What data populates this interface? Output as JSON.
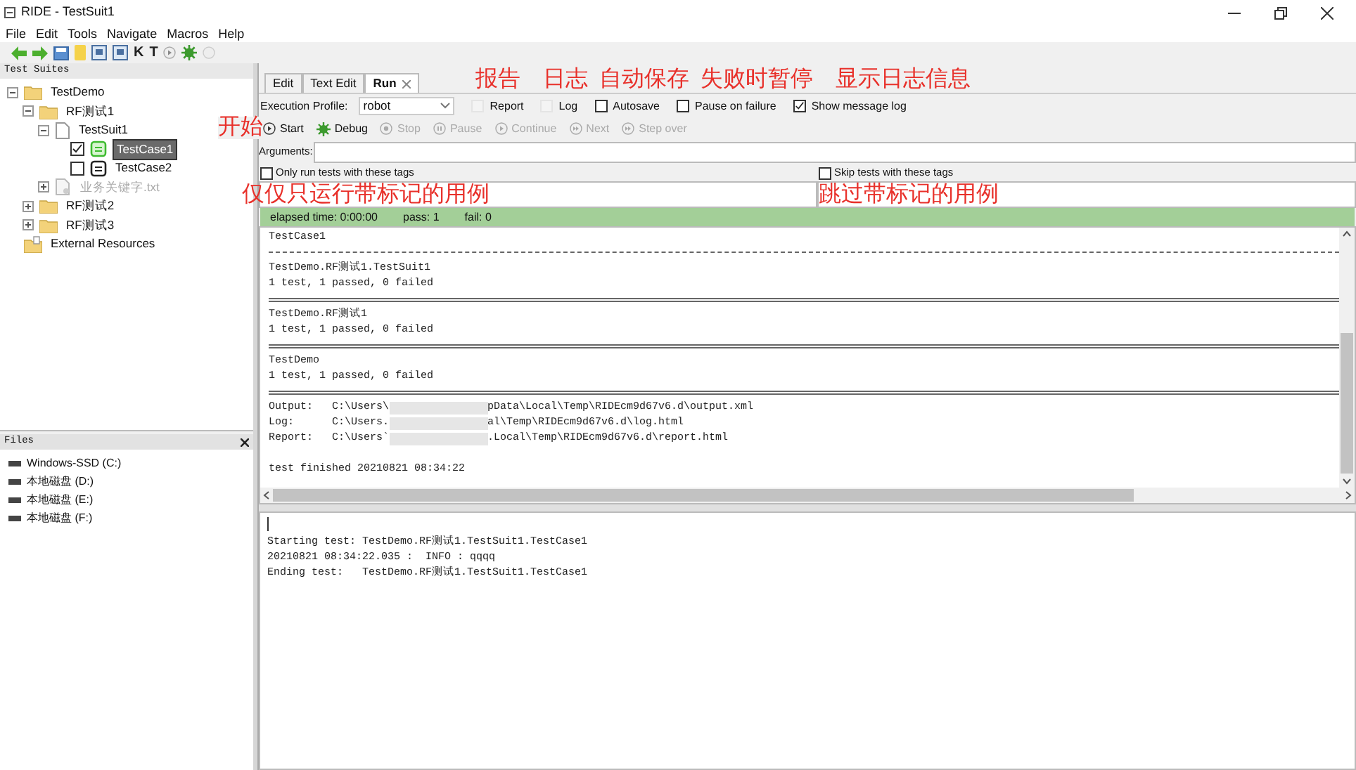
{
  "window": {
    "title": "RIDE - TestSuit1"
  },
  "menu": [
    "File",
    "Edit",
    "Tools",
    "Navigate",
    "Macros",
    "Help"
  ],
  "toolbar": {
    "letter_buttons": [
      "K",
      "T"
    ]
  },
  "test_suites": {
    "title": "Test Suites",
    "tree": [
      {
        "label": "TestDemo",
        "kind": "folder",
        "expanded": true,
        "children": [
          {
            "label": "RF测试1",
            "kind": "folder",
            "expanded": true,
            "children": [
              {
                "label": "TestSuit1",
                "kind": "suite",
                "expanded": true,
                "children": [
                  {
                    "label": "TestCase1",
                    "kind": "test",
                    "checked": true,
                    "selected": true
                  },
                  {
                    "label": "TestCase2",
                    "kind": "test",
                    "checked": false,
                    "selected": false
                  }
                ]
              },
              {
                "label": "业务关键字.txt",
                "kind": "resource",
                "expanded": false,
                "disabled": true
              }
            ]
          },
          {
            "label": "RF测试2",
            "kind": "folder",
            "expanded": false
          },
          {
            "label": "RF测试3",
            "kind": "folder",
            "expanded": false
          }
        ]
      },
      {
        "label": "External Resources",
        "kind": "external"
      }
    ]
  },
  "files": {
    "title": "Files",
    "drives": [
      "Windows-SSD (C:)",
      "本地磁盘 (D:)",
      "本地磁盘 (E:)",
      "本地磁盘 (F:)"
    ]
  },
  "tabs": [
    {
      "label": "Edit",
      "selected": false
    },
    {
      "label": "Text Edit",
      "selected": false
    },
    {
      "label": "Run",
      "selected": true,
      "closable": true
    }
  ],
  "run": {
    "profile_label": "Execution Profile:",
    "profile": "robot",
    "options": [
      {
        "label": "Report",
        "checked": false,
        "disabled": true
      },
      {
        "label": "Log",
        "checked": false,
        "disabled": true
      },
      {
        "label": "Autosave",
        "checked": false,
        "disabled": false
      },
      {
        "label": "Pause on failure",
        "checked": false,
        "disabled": false
      },
      {
        "label": "Show message log",
        "checked": true,
        "disabled": false
      }
    ],
    "controls": [
      {
        "label": "Start",
        "kind": "start",
        "disabled": false
      },
      {
        "label": "Debug",
        "kind": "debug",
        "disabled": false
      },
      {
        "label": "Stop",
        "kind": "stop",
        "disabled": true
      },
      {
        "label": "Pause",
        "kind": "pause",
        "disabled": true
      },
      {
        "label": "Continue",
        "kind": "continue",
        "disabled": true
      },
      {
        "label": "Next",
        "kind": "next",
        "disabled": true
      },
      {
        "label": "Step over",
        "kind": "step",
        "disabled": true
      }
    ],
    "arguments_label": "Arguments:",
    "include_tags": {
      "label": "Only run tests with these tags",
      "checked": false
    },
    "exclude_tags": {
      "label": "Skip tests with these tags",
      "checked": false
    },
    "status": {
      "elapsed": "elapsed time: 0:00:00",
      "pass": "pass: 1",
      "fail": "fail: 0"
    }
  },
  "output": {
    "lines": [
      {
        "kind": "text",
        "text": "TestCase1"
      },
      {
        "kind": "dashed_rule"
      },
      {
        "kind": "text",
        "text": "TestDemo.RF测试1.TestSuit1"
      },
      {
        "kind": "text",
        "text": "1 test, 1 passed, 0 failed"
      },
      {
        "kind": "double_rule"
      },
      {
        "kind": "text",
        "text": "TestDemo.RF测试1"
      },
      {
        "kind": "text",
        "text": "1 test, 1 passed, 0 failed"
      },
      {
        "kind": "double_rule"
      },
      {
        "kind": "text",
        "text": "TestDemo"
      },
      {
        "kind": "text",
        "text": "1 test, 1 passed, 0 failed"
      },
      {
        "kind": "double_rule"
      },
      {
        "kind": "path",
        "label": "Output:",
        "before": "C:\\Users\\",
        "after": "pData\\Local\\Temp\\RIDEcm9d67v6.d\\output.xml"
      },
      {
        "kind": "path",
        "label": "Log:",
        "before": "C:\\Users.",
        "after": "al\\Temp\\RIDEcm9d67v6.d\\log.html"
      },
      {
        "kind": "path",
        "label": "Report:",
        "before": "C:\\Users`",
        "after": ".Local\\Temp\\RIDEcm9d67v6.d\\report.html"
      },
      {
        "kind": "blank"
      },
      {
        "kind": "text",
        "text": "test finished 20210821 08:34:22"
      }
    ]
  },
  "message_log": {
    "lines": [
      "Starting test: TestDemo.RF测试1.TestSuit1.TestCase1",
      "20210821 08:34:22.035 :  INFO : qqqq",
      "Ending test:   TestDemo.RF测试1.TestSuit1.TestCase1"
    ]
  },
  "annotations": {
    "options": [
      "报告",
      "日志",
      "自动保存",
      "失败时暂停",
      "显示日志信息"
    ],
    "start": "开始",
    "include_tags": "仅仅只运行带标记的用例",
    "exclude_tags": "跳过带标记的用例"
  }
}
